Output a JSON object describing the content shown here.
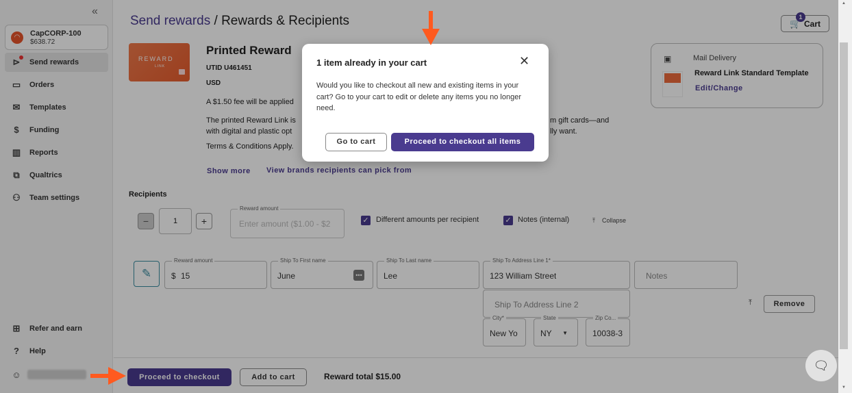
{
  "sidebar": {
    "collapse_icon": "double-chevron-left-icon",
    "account": {
      "name": "CapCORP-100",
      "balance": "$638.72"
    },
    "items": [
      {
        "label": "Send rewards",
        "icon": "send-icon"
      },
      {
        "label": "Orders",
        "icon": "folder-icon"
      },
      {
        "label": "Templates",
        "icon": "mail-icon"
      },
      {
        "label": "Funding",
        "icon": "dollar-icon"
      },
      {
        "label": "Reports",
        "icon": "chart-icon"
      },
      {
        "label": "Qualtrics",
        "icon": "qualtrics-icon"
      },
      {
        "label": "Team settings",
        "icon": "team-icon"
      }
    ],
    "bottom_items": [
      {
        "label": "Refer and earn",
        "icon": "gift-icon"
      },
      {
        "label": "Help",
        "icon": "help-icon"
      }
    ]
  },
  "header": {
    "breadcrumb_link": "Send rewards",
    "breadcrumb_sep": " / ",
    "breadcrumb_current": "Rewards & Recipients",
    "cart_label": "Cart",
    "cart_count": "1"
  },
  "product": {
    "image_text": "REWARD",
    "image_subtext": "LINK",
    "title": "Printed Reward",
    "utid": "UTID U461451",
    "currency": "USD",
    "fee": "A $1.50 fee will be applied",
    "desc_line1": "The printed Reward Link is",
    "desc_line1_end": "m gift cards—and",
    "desc_line2": "with digital and plastic opt",
    "desc_line2_end": "lly want.",
    "terms": "Terms & Conditions Apply.",
    "show_more": "Show more",
    "brands_link": "View brands recipients can pick from"
  },
  "mail": {
    "title": "Mail Delivery",
    "template": "Reward Link Standard Template",
    "edit": "Edit/Change"
  },
  "recipients": {
    "label": "Recipients",
    "quantity": "1",
    "minus": "−",
    "plus": "+",
    "amount_label": "Reward amount",
    "amount_placeholder": "Enter amount ($1.00 - $2",
    "different_amounts": "Different amounts per recipient",
    "notes_internal": "Notes (internal)",
    "collapse": "Collapse"
  },
  "row": {
    "reward_amount_label": "Reward amount",
    "reward_prefix": "$",
    "reward_amount": "15",
    "first_name_label": "Ship To First name",
    "first_name": "June",
    "last_name_label": "Ship To Last name",
    "last_name": "Lee",
    "addr1_label": "Ship To Address Line 1*",
    "addr1": "123 William Street",
    "notes_placeholder": "Notes",
    "addr2_placeholder": "Ship To Address Line 2",
    "city_label": "City*",
    "city": "New Yo",
    "state_label": "State",
    "state": "NY",
    "zip_label": "Zip Co...",
    "zip": "10038-3",
    "remove": "Remove"
  },
  "footer": {
    "checkout": "Proceed to checkout",
    "add_to_cart": "Add to cart",
    "total": "Reward total $15.00"
  },
  "modal": {
    "title": "1 item already in your cart",
    "body": "Would you like to checkout all new and existing items in your cart? Go to your cart to edit or delete any items you no longer need.",
    "go_to_cart": "Go to cart",
    "checkout_all": "Proceed to checkout all items"
  },
  "colors": {
    "accent": "#4a3b8f",
    "arrow": "#ff5a1f",
    "brand_orange": "#e8542b"
  }
}
